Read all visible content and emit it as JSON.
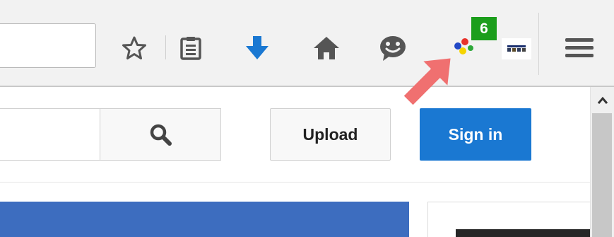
{
  "toolbar": {
    "icons": [
      "star-bookmark-icon",
      "reading-list-icon",
      "download-icon",
      "home-icon",
      "chat-icon",
      "extension-icon",
      "flag-extension-icon",
      "hamburger-menu-icon"
    ],
    "badge_count": "6",
    "colors": {
      "download": "#1a78d2",
      "badge": "#1c9e1c",
      "arrow": "#f07070"
    }
  },
  "page": {
    "upload_label": "Upload",
    "signin_label": "Sign in",
    "colors": {
      "signin_bg": "#1a78d2",
      "panel": "#3d6dbf"
    }
  }
}
